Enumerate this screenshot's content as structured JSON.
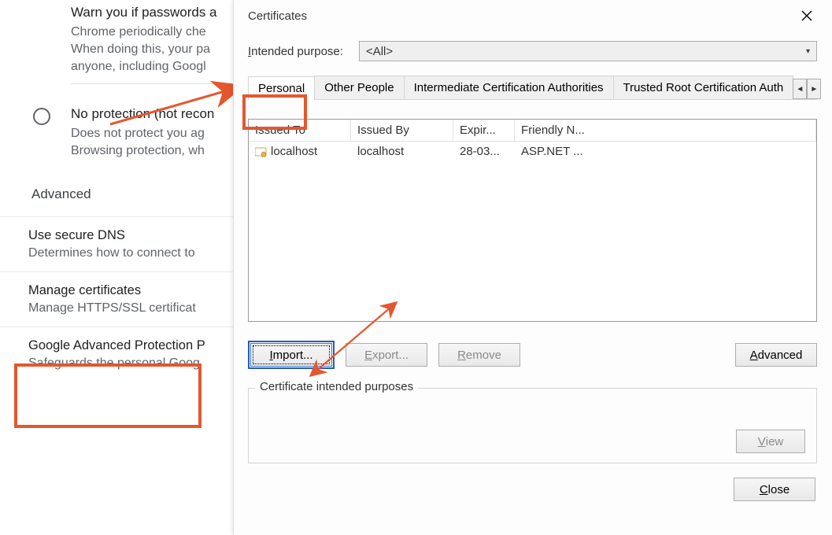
{
  "chrome": {
    "warn": {
      "title": "Warn you if passwords a",
      "l1": "Chrome periodically che",
      "l2": "When doing this, your pa",
      "l3": "anyone, including Googl"
    },
    "noprotect": {
      "title": "No protection (not recon",
      "l1": "Does not protect you ag",
      "l2": "Browsing protection, wh"
    },
    "advanced_header": "Advanced",
    "dns": {
      "title": "Use secure DNS",
      "desc": "Determines how to connect to"
    },
    "manage": {
      "title": "Manage certificates",
      "desc": "Manage HTTPS/SSL certificat"
    },
    "gap": {
      "title": "Google Advanced Protection P",
      "desc": "Safeguards the personal Goog"
    }
  },
  "dialog": {
    "title": "Certificates",
    "purpose_label_prefix": "I",
    "purpose_label_rest": "ntended purpose:",
    "purpose_value": "<All>",
    "tabs": [
      "Personal",
      "Other People",
      "Intermediate Certification Authorities",
      "Trusted Root Certification Auth"
    ],
    "columns": {
      "c1": "Issued To",
      "c2": "Issued By",
      "c3": "Expir...",
      "c4": "Friendly N..."
    },
    "row": {
      "issued_to": "localhost",
      "issued_by": "localhost",
      "expiry": "28-03...",
      "friendly": "ASP.NET ..."
    },
    "import_u": "I",
    "import_rest": "mport...",
    "export_u": "E",
    "export_rest": "xport...",
    "remove_u": "R",
    "remove_rest": "emove",
    "advanced_u": "A",
    "advanced_rest": "dvanced",
    "group_label": "Certificate intended purposes",
    "view_u": "V",
    "view_rest": "iew",
    "close_u": "C",
    "close_rest": "lose"
  }
}
